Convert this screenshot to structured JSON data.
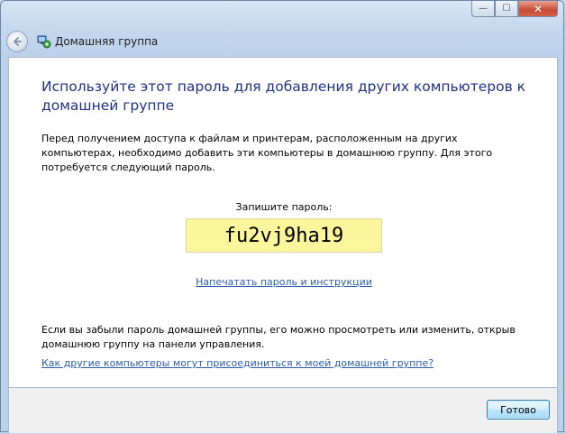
{
  "window": {
    "caption_buttons": {
      "minimize_glyph": "—",
      "maximize_glyph": "☐",
      "close_glyph": "✕"
    }
  },
  "nav": {
    "back_icon": "back-arrow-icon",
    "app_icon": "homegroup-icon",
    "title": "Домашняя группа"
  },
  "main": {
    "title": "Используйте этот пароль для добавления других компьютеров к домашней группе",
    "description": "Перед получением доступа к файлам и принтерам, расположенным на других компьютерах, необходимо добавить эти компьютеры в домашнюю группу. Для этого потребуется следующий пароль.",
    "password_label": "Запишите пароль:",
    "password": "fu2vj9ha19",
    "print_link": "Напечатать пароль и инструкции",
    "forgot_text": "Если вы забыли пароль домашней группы, его можно просмотреть или изменить, открыв домашнюю группу на панели управления.",
    "join_link": "Как другие компьютеры могут присоединиться к моей домашней группе?"
  },
  "footer": {
    "done_label": "Готово"
  },
  "colors": {
    "title": "#1e3287",
    "link": "#2a5db0",
    "password_bg": "#fbf59b",
    "close_button": "#c74a35"
  }
}
